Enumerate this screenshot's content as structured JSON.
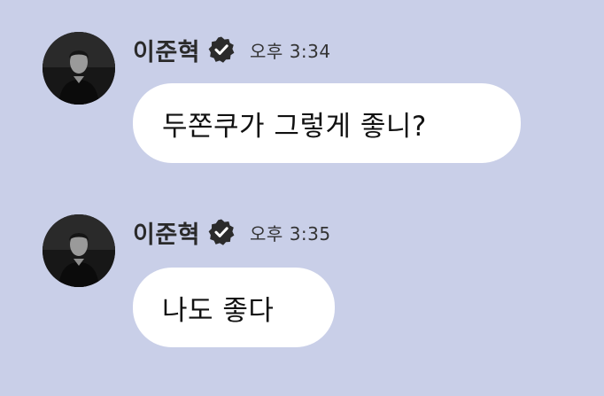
{
  "conversation": {
    "messages": [
      {
        "sender": "이준혁",
        "verified_icon": "verified-badge-icon",
        "time": "오후 3:34",
        "text": "두쫀쿠가 그렇게 좋니?"
      },
      {
        "sender": "이준혁",
        "verified_icon": "verified-badge-icon",
        "time": "오후 3:35",
        "text": "나도 좋다"
      }
    ]
  },
  "colors": {
    "background": "#c9cfe8",
    "bubble": "#ffffff",
    "name_text": "#2a2a2a",
    "badge": "#2b2b2b"
  }
}
